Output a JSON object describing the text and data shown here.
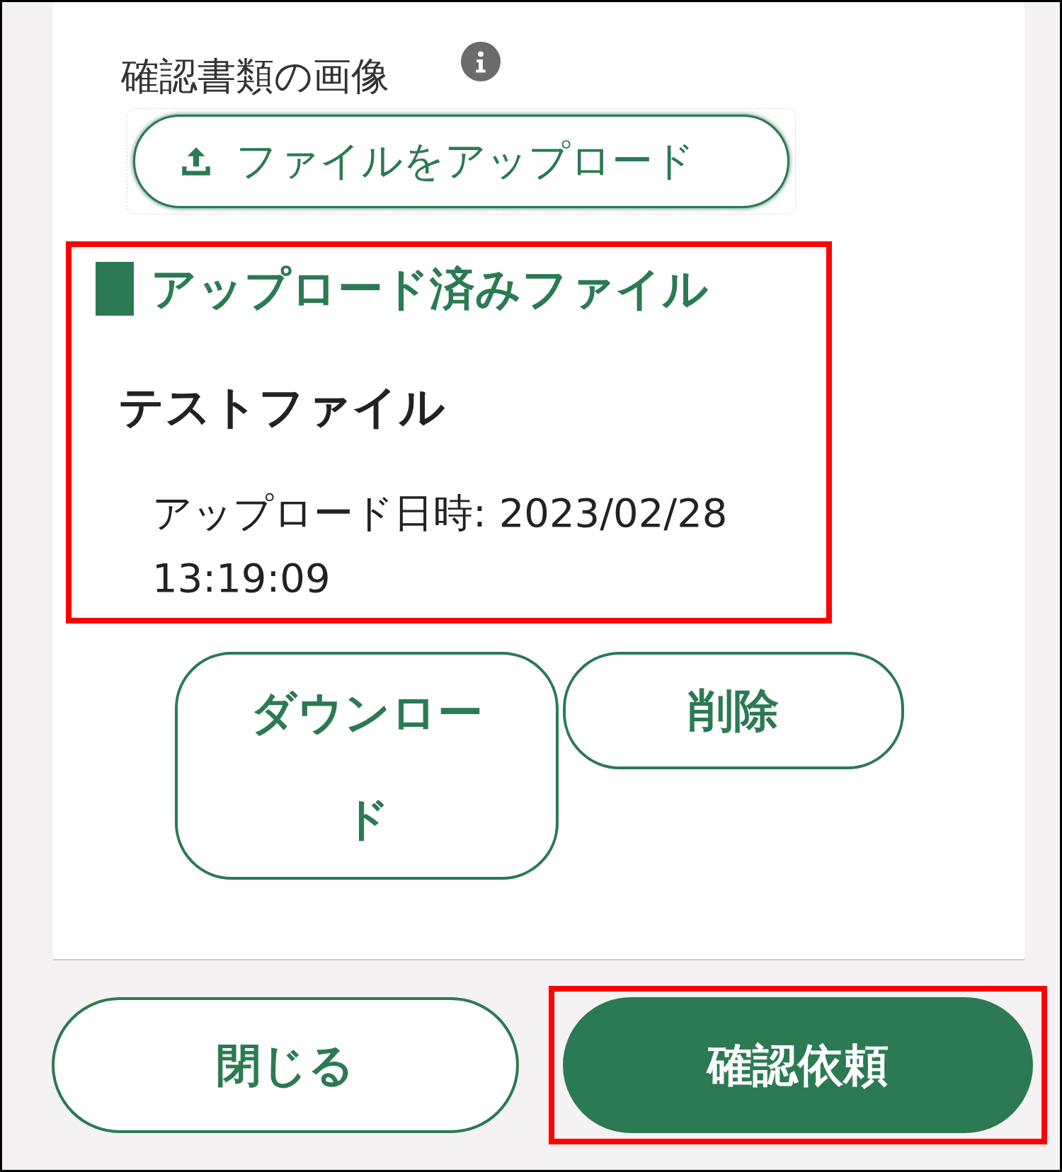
{
  "field": {
    "label": "確認書類の画像",
    "upload_button": "ファイルをアップロード"
  },
  "uploaded": {
    "highlighted": true,
    "heading": "アップロード済みファイル",
    "file_name": "テストファイル",
    "uploaded_at": "アップロード日時: 2023/02/28 13:19:09",
    "actions": [
      {
        "label": "ダウンロード"
      },
      {
        "label": "削除"
      }
    ]
  },
  "footer": {
    "buttons": [
      {
        "label": "閉じる",
        "kind": "outline",
        "highlighted": false
      },
      {
        "label": "確認依頼",
        "kind": "primary",
        "highlighted": true
      }
    ]
  }
}
